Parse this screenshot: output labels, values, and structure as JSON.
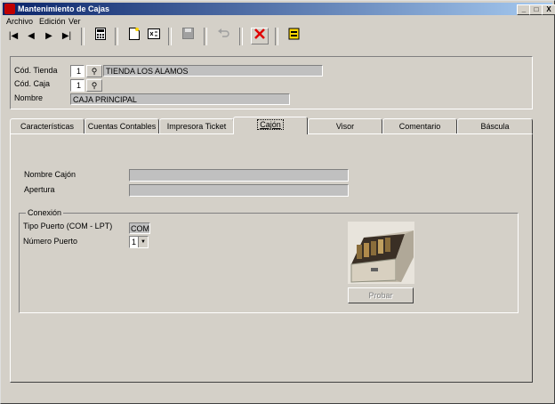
{
  "window": {
    "title": "Mantenimiento de Cajas",
    "controls": [
      "_",
      "□",
      "X"
    ]
  },
  "menu": [
    {
      "label": "Archivo"
    },
    {
      "label": "Edición"
    },
    {
      "label": "Ver"
    }
  ],
  "toolbar": {
    "first": "|◀",
    "prev": "◀",
    "next": "▶",
    "last": "▶|",
    "icons": [
      "calculator-icon",
      "new-icon",
      "copy-icon",
      "save-icon",
      "undo-icon",
      "delete-icon",
      "export-icon"
    ],
    "delete_color": "#e00000"
  },
  "header": {
    "tienda_label": "Cód. Tienda",
    "tienda_code": "1",
    "tienda_name": "TIENDA LOS ALAMOS",
    "caja_label": "Cód. Caja",
    "caja_code": "1",
    "nombre_label": "Nombre",
    "nombre_value": "CAJA PRINCIPAL"
  },
  "tabs": [
    {
      "label": "Características"
    },
    {
      "label": "Cuentas Contables"
    },
    {
      "label": "Impresora Ticket"
    },
    {
      "label": "Cajón",
      "active": true
    },
    {
      "label": "Visor"
    },
    {
      "label": "Comentario"
    },
    {
      "label": "Báscula"
    }
  ],
  "cajon": {
    "nombre_label": "Nombre Cajón",
    "nombre_value": "",
    "apertura_label": "Apertura",
    "apertura_value": "",
    "conexion_title": "Conexión",
    "tipo_label": "Tipo Puerto (COM - LPT)",
    "tipo_value": "COM",
    "numero_label": "Número Puerto",
    "numero_value": "1",
    "probar_label": "Probar"
  }
}
